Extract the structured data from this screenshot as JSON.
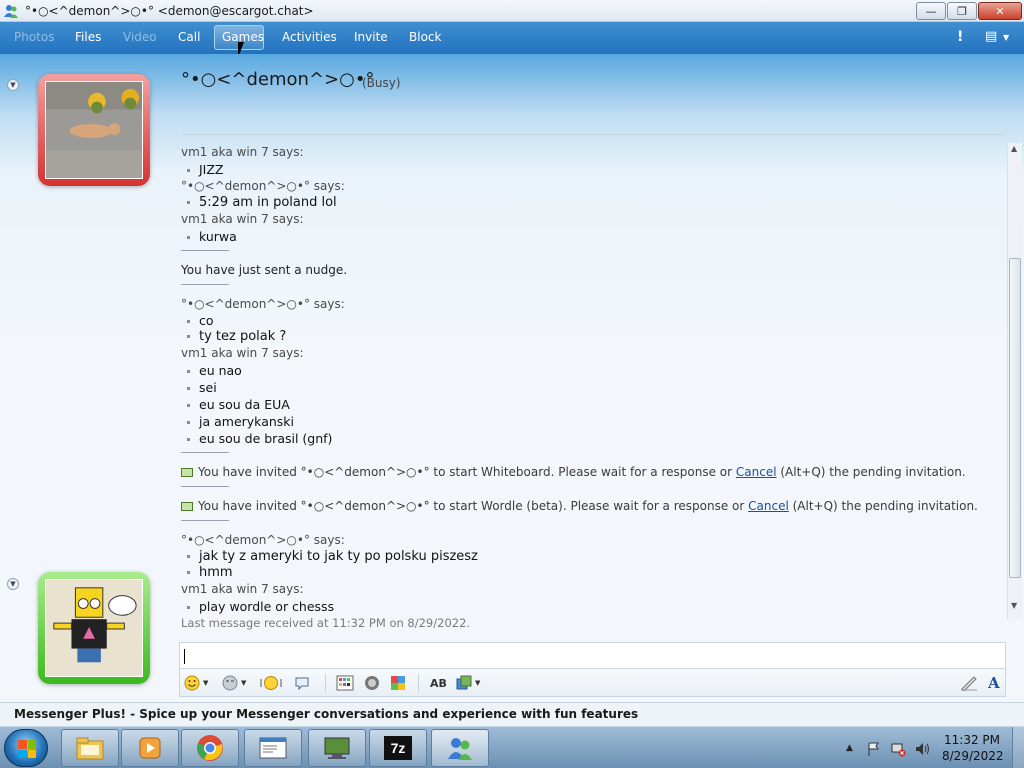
{
  "window": {
    "title": "°•○<^demon^>○•° <demon@escargot.chat>",
    "controls": {
      "minimize": "—",
      "maximize": "❐",
      "close": "✕"
    }
  },
  "menu": {
    "items": [
      {
        "label": "Photos",
        "enabled": false
      },
      {
        "label": "Files",
        "enabled": true
      },
      {
        "label": "Video",
        "enabled": false
      },
      {
        "label": "Call",
        "enabled": true
      },
      {
        "label": "Games",
        "enabled": true,
        "hovered": true
      },
      {
        "label": "Activities",
        "enabled": true
      },
      {
        "label": "Invite",
        "enabled": true
      },
      {
        "label": "Block",
        "enabled": true
      }
    ],
    "alert_glyph": "!",
    "options_glyph": "▤"
  },
  "contact": {
    "name": "°•○<^demon^>○•°",
    "status": "(Busy)"
  },
  "chat": {
    "messages": [
      {
        "type": "says",
        "text": "vm1 aka win 7 says:"
      },
      {
        "type": "msg",
        "text": "JIZZ"
      },
      {
        "type": "says",
        "text": "°•○<^demon^>○•° says:"
      },
      {
        "type": "msg",
        "text": "5:29 am in poland lol"
      },
      {
        "type": "says",
        "text": "vm1 aka win 7 says:"
      },
      {
        "type": "msg",
        "text": "kurwa"
      },
      {
        "type": "sep"
      },
      {
        "type": "sys",
        "text": "You have just sent a nudge."
      },
      {
        "type": "sep"
      },
      {
        "type": "says",
        "text": "°•○<^demon^>○•° says:"
      },
      {
        "type": "msg",
        "text": "co"
      },
      {
        "type": "msg",
        "text": "ty tez polak ?"
      },
      {
        "type": "says",
        "text": "vm1 aka win 7 says:"
      },
      {
        "type": "msg",
        "text": "eu nao"
      },
      {
        "type": "msg",
        "text": "sei"
      },
      {
        "type": "msg",
        "text": "eu sou da EUA"
      },
      {
        "type": "msg",
        "text": "ja amerykanski"
      },
      {
        "type": "msg",
        "text": "eu sou de brasil (gnf)"
      },
      {
        "type": "sep"
      },
      {
        "type": "invite",
        "before": "You have invited °•○<^demon^>○•° to start Whiteboard. Please wait for a response or ",
        "link": "Cancel",
        "after": " (Alt+Q) the pending invitation."
      },
      {
        "type": "sep"
      },
      {
        "type": "invite",
        "before": "You have invited °•○<^demon^>○•° to start Wordle (beta). Please wait for a response or ",
        "link": "Cancel",
        "after": " (Alt+Q) the pending invitation."
      },
      {
        "type": "sep"
      },
      {
        "type": "says",
        "text": "°•○<^demon^>○•° says:"
      },
      {
        "type": "msg",
        "text": "jak ty z ameryki to jak ty po polsku piszesz"
      },
      {
        "type": "msg",
        "text": "hmm"
      },
      {
        "type": "says",
        "text": "vm1 aka win 7 says:"
      },
      {
        "type": "msg",
        "text": "play wordle or chesss"
      }
    ],
    "last_received": "Last message received at 11:32 PM on 8/29/2022."
  },
  "toolbar": {
    "emoticons_icon": "smiley-icon",
    "winks_icon": "wink-icon",
    "nudge_icon": "nudge-icon",
    "voiceclip_icon": "voice-clip-icon",
    "background_icon": "background-icon",
    "games_icon": "games-icon",
    "ink_icon": "ink-icon",
    "spellcheck_label": "AB",
    "font_label": "A"
  },
  "adbar": {
    "text": "Messenger Plus! - Spice up your Messenger conversations and experience with fun features"
  },
  "taskbar": {
    "seven_zip_label": "7z",
    "clock_time": "11:32 PM",
    "clock_date": "8/29/2022"
  },
  "colors": {
    "busy_frame": "#d43232",
    "online_frame": "#3cb91e",
    "menubar": "#2d7fc7",
    "link": "#1a4fa0"
  }
}
